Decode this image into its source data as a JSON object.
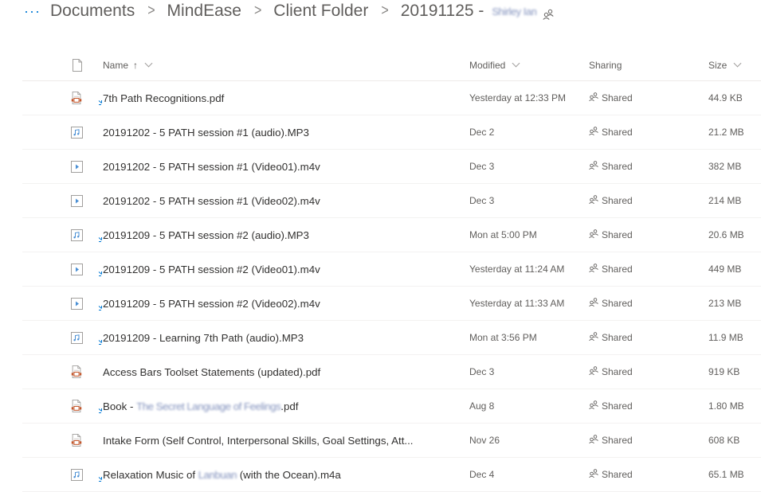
{
  "breadcrumb": {
    "more_label": "···",
    "items": [
      "Documents",
      "MindEase",
      "Client Folder",
      "20191125 -"
    ],
    "separator": ">",
    "redacted_suffix": "Shirley Ian"
  },
  "columns": {
    "type_icon": "file-type-icon",
    "name": "Name",
    "name_sort": "↑",
    "modified": "Modified",
    "sharing": "Sharing",
    "size": "Size"
  },
  "colors": {
    "accent": "#0078d4",
    "pdf_icon": "#c4572c",
    "media_icon": "#4a8fd4",
    "text_primary": "#323130",
    "text_secondary": "#605e5c"
  },
  "files": [
    {
      "name": "7th Path Recognitions.pdf",
      "type": "pdf",
      "is_new": true,
      "modified": "Yesterday at 12:33 PM",
      "sharing": "Shared",
      "size": "44.9 KB"
    },
    {
      "name": "20191202 - 5 PATH session #1 (audio).MP3",
      "type": "audio",
      "is_new": false,
      "modified": "Dec 2",
      "sharing": "Shared",
      "size": "21.2 MB"
    },
    {
      "name": "20191202 - 5 PATH session #1 (Video01).m4v",
      "type": "video",
      "is_new": false,
      "modified": "Dec 3",
      "sharing": "Shared",
      "size": "382 MB"
    },
    {
      "name": "20191202 - 5 PATH session #1 (Video02).m4v",
      "type": "video",
      "is_new": false,
      "modified": "Dec 3",
      "sharing": "Shared",
      "size": "214 MB"
    },
    {
      "name": "20191209 - 5 PATH session #2 (audio).MP3",
      "type": "audio",
      "is_new": true,
      "modified": "Mon at 5:00 PM",
      "sharing": "Shared",
      "size": "20.6 MB"
    },
    {
      "name": "20191209 - 5 PATH session #2 (Video01).m4v",
      "type": "video",
      "is_new": true,
      "modified": "Yesterday at 11:24 AM",
      "sharing": "Shared",
      "size": "449 MB"
    },
    {
      "name": "20191209 - 5 PATH session #2 (Video02).m4v",
      "type": "video",
      "is_new": true,
      "modified": "Yesterday at 11:33 AM",
      "sharing": "Shared",
      "size": "213 MB"
    },
    {
      "name": "20191209 - Learning 7th Path (audio).MP3",
      "type": "audio",
      "is_new": true,
      "modified": "Mon at 3:56 PM",
      "sharing": "Shared",
      "size": "11.9 MB"
    },
    {
      "name": "Access Bars Toolset Statements (updated).pdf",
      "type": "pdf",
      "is_new": false,
      "modified": "Dec 3",
      "sharing": "Shared",
      "size": "919 KB"
    },
    {
      "name_parts": [
        "Book - ",
        "The Secret Language of Feelings",
        ".pdf"
      ],
      "type": "pdf",
      "is_new": true,
      "modified": "Aug 8",
      "sharing": "Shared",
      "size": "1.80 MB"
    },
    {
      "name": "Intake Form (Self Control, Interpersonal Skills, Goal Settings, Att...",
      "type": "pdf",
      "is_new": false,
      "modified": "Nov 26",
      "sharing": "Shared",
      "size": "608 KB"
    },
    {
      "name_parts": [
        "Relaxation Music of ",
        "Lanbuan",
        " (with the Ocean).m4a"
      ],
      "type": "audio",
      "is_new": true,
      "modified": "Dec 4",
      "sharing": "Shared",
      "size": "65.1 MB"
    }
  ]
}
